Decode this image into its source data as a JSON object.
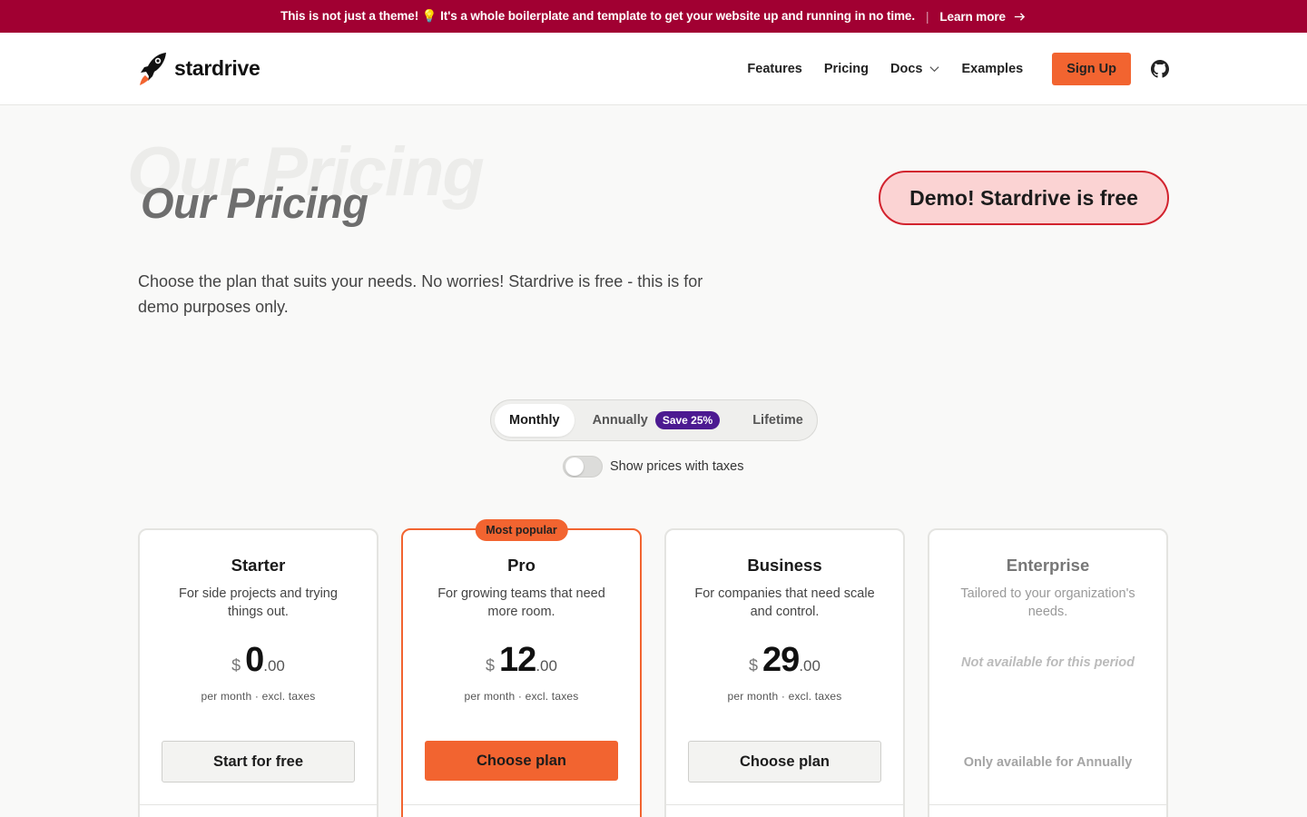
{
  "banner": {
    "message": "This is not just a theme! 💡 It's a whole boilerplate and template to get your website up and running in no time.",
    "separator": "|",
    "link_label": "Learn more",
    "link_icon": "arrow-right-icon"
  },
  "header": {
    "brand": "stardrive",
    "logo_icon": "rocket-icon",
    "nav": [
      {
        "label": "Features"
      },
      {
        "label": "Pricing"
      },
      {
        "label": "Docs",
        "icon": "chevron-down-icon"
      },
      {
        "label": "Examples"
      }
    ],
    "signup_label": "Sign Up",
    "github_icon": "github-icon"
  },
  "hero": {
    "ghost_title": "Our Pricing",
    "title": "Our Pricing",
    "demo_badge": "Demo! Stardrive is free",
    "subtitle": "Choose the plan that suits your needs. No worries! Stardrive is free - this is for demo purposes only."
  },
  "billing": {
    "options": [
      "Monthly",
      "Annually",
      "Lifetime"
    ],
    "selected": "Monthly",
    "save_badge": "Save 25%",
    "tax_toggle_label": "Show prices with taxes",
    "tax_toggle_on": false
  },
  "plans": [
    {
      "name": "Starter",
      "description": "For side projects and trying things out.",
      "currency": "$",
      "amount": "0",
      "cents": ".00",
      "period": "per month · excl. taxes",
      "cta": "Start for free"
    },
    {
      "name": "Pro",
      "badge": "Most popular",
      "description": "For growing teams that need more room.",
      "currency": "$",
      "amount": "12",
      "cents": ".00",
      "period": "per month · excl. taxes",
      "cta": "Choose plan"
    },
    {
      "name": "Business",
      "description": "For companies that need scale and control.",
      "currency": "$",
      "amount": "29",
      "cents": ".00",
      "period": "per month · excl. taxes",
      "cta": "Choose plan"
    },
    {
      "name": "Enterprise",
      "description": "Tailored to your organization's needs.",
      "unavailable": "Not available for this period",
      "availability_note": "Only available for Annually"
    }
  ],
  "colors": {
    "banner": "#a10032",
    "accent": "#f26430",
    "save_badge": "#4c1a91",
    "demo_badge_border": "#d2232e",
    "demo_badge_bg": "#fbd3d3"
  }
}
